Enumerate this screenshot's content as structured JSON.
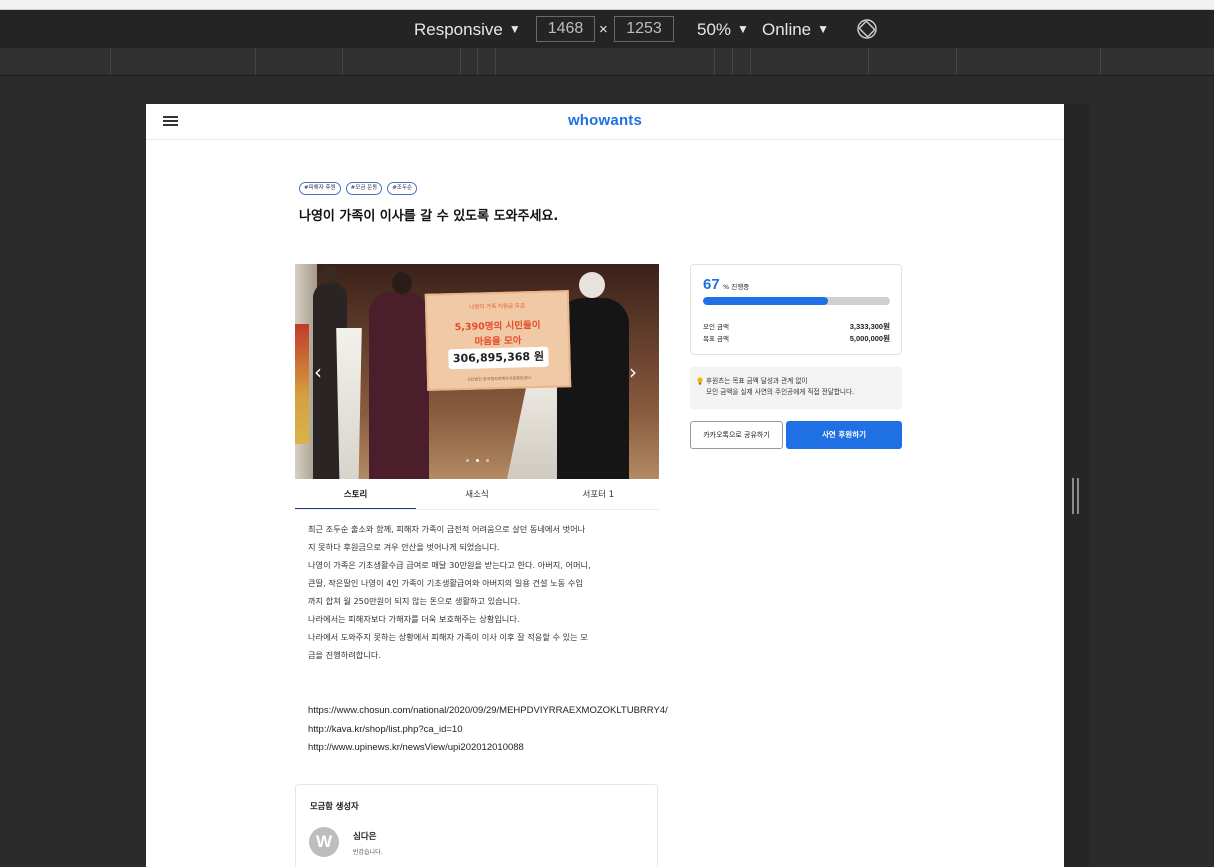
{
  "devtools": {
    "device": "Responsive",
    "width": "1468",
    "height": "1253",
    "times": "×",
    "zoom": "50%",
    "network": "Online",
    "caret": "▼"
  },
  "site": {
    "logo": "whowants"
  },
  "campaign": {
    "tags": [
      "#피해자 후원",
      "#모금 운동",
      "#조두순"
    ],
    "title": "나영이 가족이 이사를 갈 수 있도록 도와주세요.",
    "photo_board": {
      "line1": "나영이 가족 지원금 모금",
      "line2": "5,390명의 시민들이",
      "line3": "마음을 모아",
      "amount": "306,895,368 원",
      "foot": "사단법인 한국범죄피해자지원중앙센터"
    },
    "carousel": {
      "prev": "‹",
      "next": "›",
      "slide_count": 3,
      "active_slide": 2
    }
  },
  "tabs": [
    {
      "label": "스토리",
      "active": true
    },
    {
      "label": "새소식",
      "active": false
    },
    {
      "label": "서포터 1",
      "active": false
    }
  ],
  "story": [
    "최근 조두순 출소와 함께, 피해자 가족이 금전적 어려움으로 살던 동네에서 벗어나",
    "지 못하다 후원금으로 겨우 안산을 벗어나게 되었습니다.",
    "나영이 가족은 기초생활수급 급여로 매달 30만원을 받는다고 한다. 아버지, 어머니,",
    "큰딸, 작은딸인 나영이 4인 가족이 기초생활급여와 아버지의 일용 건설 노동 수입",
    "까지 합쳐 월 250만원이 되지 않는 돈으로 생활하고 있습니다.",
    "나라에서는 피해자보다 가해자를 더욱 보호해주는 상황입니다.",
    "나라에서 도와주지 못하는 상황에서 피해자 가족이 이사 이후 잘 적응할 수 있는 모",
    "금을 진행하려합니다."
  ],
  "links": [
    "https://www.chosun.com/national/2020/09/29/MEHPDVIYRRAEXMOZOKLTUBRRY4/",
    "http://kava.kr/shop/list.php?ca_id=10",
    "http://www.upinews.kr/newsView/upi202012010088"
  ],
  "creator": {
    "heading": "모금함 생성자",
    "avatar_letter": "W",
    "name": "심다은",
    "message": "반갑습니다."
  },
  "progress": {
    "percent": "67",
    "percent_label": "% 진행중",
    "fill_fraction": 0.67,
    "raised_label": "모인 금액",
    "raised_value": "3,333,300원",
    "goal_label": "목표 금액",
    "goal_value": "5,000,000원"
  },
  "notice": {
    "line1": "후원츠는 목표 금액 달성과 관계 없이",
    "line2": "모인 금액을 실제 사연의 주인공에게 직접 전달합니다."
  },
  "buttons": {
    "share": "카카오톡으로 공유하기",
    "donate": "사연 후원하기"
  },
  "colors": {
    "brand": "#1f6fe5",
    "tag_border": "#3f73c9"
  },
  "icons": {
    "menu": "hamburger-icon",
    "rotate": "rotate-device-icon",
    "notice": "lightbulb-icon"
  }
}
